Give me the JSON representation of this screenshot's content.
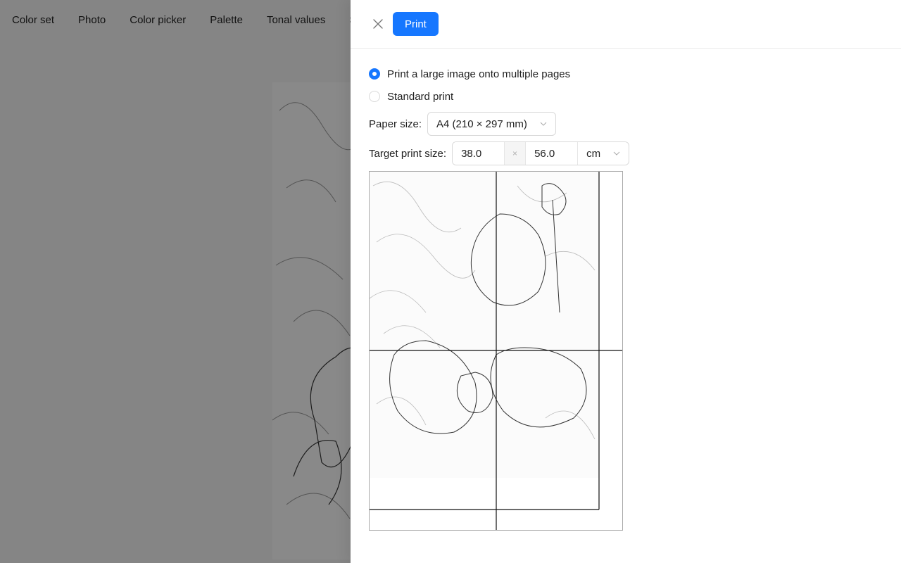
{
  "topnav": {
    "items": [
      "Color set",
      "Photo",
      "Color picker",
      "Palette",
      "Tonal values",
      "S"
    ]
  },
  "drawer": {
    "close_icon": "close-icon",
    "print_label": "Print",
    "mode_options": [
      {
        "label": "Print a large image onto multiple pages",
        "checked": true
      },
      {
        "label": "Standard print",
        "checked": false
      }
    ],
    "paper_size": {
      "label": "Paper size",
      "value": "A4 (210 × 297 mm)"
    },
    "target_size": {
      "label": "Target print size",
      "width": "38.0",
      "separator": "×",
      "height": "56.0",
      "unit": "cm"
    },
    "preview": {
      "pages_across": 2,
      "pages_down": 2,
      "image_description": "pencil sketch of dahlia flowers"
    }
  }
}
